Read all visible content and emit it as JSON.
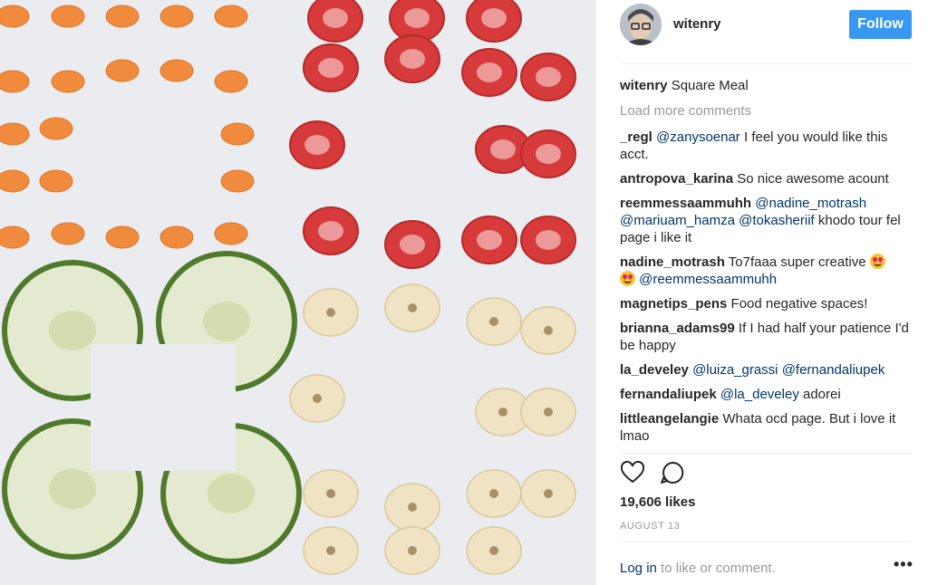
{
  "post": {
    "username": "witenry",
    "follow_label": "Follow",
    "caption_author": "witenry",
    "caption_text": "Square Meal",
    "load_more": "Load more comments",
    "likes": "19,606 likes",
    "date": "AUGUST 13",
    "login_link": "Log in",
    "login_text": " to like or comment.",
    "more_label": "•••"
  },
  "comments": [
    {
      "author": "_regl",
      "mentions": [
        "@zanysoenar"
      ],
      "text": " I feel you would like this acct."
    },
    {
      "author": "antropova_karina",
      "mentions": [],
      "text": "So nice awesome acount"
    },
    {
      "author": "reemmessaammuhh",
      "mentions": [
        "@nadine_motrash",
        "@mariuam_hamza",
        "@tokasheriif"
      ],
      "text": " khodo tour fel page i like it"
    },
    {
      "author": "nadine_motrash",
      "mentions": [
        "@reemmessaammuhh"
      ],
      "text_before": "To7faaa super creative ",
      "emoji": "heart-eyes"
    },
    {
      "author": "magnetips_pens",
      "mentions": [],
      "text": "Food negative spaces!"
    },
    {
      "author": "brianna_adams99",
      "mentions": [],
      "text": "If I had half your patience I'd be happy"
    },
    {
      "author": "la_develey",
      "mentions": [
        "@luiza_grassi",
        "@fernandaliupek"
      ],
      "text": ""
    },
    {
      "author": "fernandaliupek",
      "mentions": [
        "@la_develey"
      ],
      "text": " adorei"
    },
    {
      "author": "littleangelangie",
      "mentions": [],
      "text": "Whata ocd page. But i love it lmao"
    }
  ],
  "icons": {
    "like": "heart-icon",
    "comment": "speech-bubble-icon",
    "more": "more-options-icon"
  },
  "colors": {
    "follow_button": "#3897f0",
    "mention": "#003569",
    "muted": "#999999",
    "carrot": "#f08a3c",
    "strawberry": "#d63a3a",
    "cucumber": "#4f7a2c",
    "banana": "#efe3c4"
  }
}
